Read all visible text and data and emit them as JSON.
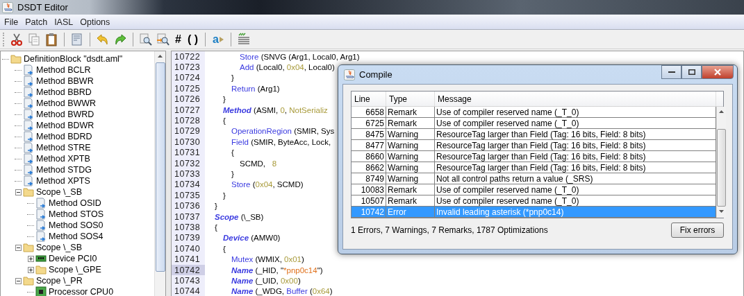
{
  "window": {
    "title": "DSDT Editor"
  },
  "menu": [
    "File",
    "Patch",
    "IASL",
    "Options"
  ],
  "toolbar": [
    {
      "kind": "cut"
    },
    {
      "kind": "copy"
    },
    {
      "kind": "paste"
    },
    {
      "kind": "separator"
    },
    {
      "kind": "document"
    },
    {
      "kind": "separator"
    },
    {
      "kind": "undo"
    },
    {
      "kind": "redo"
    },
    {
      "kind": "separator"
    },
    {
      "kind": "search"
    },
    {
      "kind": "find-next"
    },
    {
      "kind": "text",
      "label": "#"
    },
    {
      "kind": "text",
      "label": "( )"
    },
    {
      "kind": "separator"
    },
    {
      "kind": "text-arrow",
      "label": "a"
    },
    {
      "kind": "separator"
    },
    {
      "kind": "lines"
    }
  ],
  "tree": [
    {
      "kind": "root",
      "label": "DefinitionBlock \"dsdt.aml\"",
      "children": [
        {
          "kind": "method",
          "label": "Method BCLR"
        },
        {
          "kind": "method",
          "label": "Method BBWR"
        },
        {
          "kind": "method",
          "label": "Method BBRD"
        },
        {
          "kind": "method",
          "label": "Method BWWR"
        },
        {
          "kind": "method",
          "label": "Method BWRD"
        },
        {
          "kind": "method",
          "label": "Method BDWR"
        },
        {
          "kind": "method",
          "label": "Method BDRD"
        },
        {
          "kind": "method",
          "label": "Method STRE"
        },
        {
          "kind": "method",
          "label": "Method XPTB"
        },
        {
          "kind": "method",
          "label": "Method STDG"
        },
        {
          "kind": "method",
          "label": "Method XPTS"
        },
        {
          "kind": "scope",
          "label": "Scope \\_SB",
          "expanded": true,
          "children": [
            {
              "kind": "method",
              "label": "Method OSID"
            },
            {
              "kind": "method",
              "label": "Method STOS"
            },
            {
              "kind": "method",
              "label": "Method SOS0"
            },
            {
              "kind": "method",
              "label": "Method SOS4"
            }
          ]
        },
        {
          "kind": "scope",
          "label": "Scope \\_SB",
          "expanded": true,
          "children": [
            {
              "kind": "device",
              "label": "Device PCI0",
              "expanded": false
            },
            {
              "kind": "scope",
              "label": "Scope \\_GPE",
              "expanded": false
            }
          ]
        },
        {
          "kind": "scope",
          "label": "Scope \\_PR",
          "expanded": true,
          "children": [
            {
              "kind": "processor",
              "label": "Processor CPU0"
            }
          ]
        }
      ]
    }
  ],
  "editor": {
    "lines": [
      {
        "number": "10722",
        "selected": false,
        "tokens": [
          {
            "kind": "kw",
            "text": "Store"
          },
          {
            "kind": "plain",
            "text": " (SNVG (Arg1, Local0, Arg1)"
          }
        ]
      },
      {
        "number": "10723",
        "selected": false,
        "tokens": [
          {
            "kind": "kw",
            "text": "Add"
          },
          {
            "kind": "plain",
            "text": " (Local0, "
          },
          {
            "kind": "num",
            "text": "0x04"
          },
          {
            "kind": "plain",
            "text": ", Local0)"
          }
        ]
      },
      {
        "number": "10724",
        "selected": false,
        "tokens": [
          {
            "kind": "plain",
            "text": "}"
          }
        ]
      },
      {
        "number": "10725",
        "selected": false,
        "tokens": [
          {
            "kind": "kw",
            "text": "Return"
          },
          {
            "kind": "plain",
            "text": " (Arg1)"
          }
        ]
      },
      {
        "number": "10726",
        "selected": false,
        "tokens": [
          {
            "kind": "plain",
            "text": "}"
          }
        ]
      },
      {
        "number": "10727",
        "selected": false,
        "tokens": [
          {
            "kind": "decl",
            "text": "Method"
          },
          {
            "kind": "plain",
            "text": " (ASMI, "
          },
          {
            "kind": "num",
            "text": "0"
          },
          {
            "kind": "plain",
            "text": ", "
          },
          {
            "kind": "num",
            "text": "NotSerializ"
          }
        ]
      },
      {
        "number": "10728",
        "selected": false,
        "tokens": [
          {
            "kind": "plain",
            "text": "{"
          }
        ]
      },
      {
        "number": "10729",
        "selected": false,
        "tokens": [
          {
            "kind": "kw",
            "text": "OperationRegion"
          },
          {
            "kind": "plain",
            "text": " (SMIR, Sys"
          }
        ]
      },
      {
        "number": "10730",
        "selected": false,
        "tokens": [
          {
            "kind": "kw",
            "text": "Field"
          },
          {
            "kind": "plain",
            "text": " (SMIR, ByteAcc, Lock,"
          }
        ]
      },
      {
        "number": "10731",
        "selected": false,
        "tokens": [
          {
            "kind": "plain",
            "text": "{"
          }
        ]
      },
      {
        "number": "10732",
        "selected": false,
        "tokens": [
          {
            "kind": "plain",
            "text": "SCMD,   "
          },
          {
            "kind": "num",
            "text": "8"
          }
        ]
      },
      {
        "number": "10733",
        "selected": false,
        "tokens": [
          {
            "kind": "plain",
            "text": "}"
          }
        ]
      },
      {
        "number": "10734",
        "selected": false,
        "tokens": [
          {
            "kind": "kw",
            "text": "Store"
          },
          {
            "kind": "plain",
            "text": " ("
          },
          {
            "kind": "num",
            "text": "0x04"
          },
          {
            "kind": "plain",
            "text": ", SCMD)"
          }
        ]
      },
      {
        "number": "10735",
        "selected": false,
        "tokens": [
          {
            "kind": "plain",
            "text": "}"
          }
        ]
      },
      {
        "number": "10736",
        "selected": false,
        "tokens": [
          {
            "kind": "plain",
            "text": "}"
          }
        ]
      },
      {
        "number": "10737",
        "selected": false,
        "tokens": [
          {
            "kind": "decl",
            "text": "Scope"
          },
          {
            "kind": "plain",
            "text": " (\\_SB)"
          }
        ]
      },
      {
        "number": "10738",
        "selected": false,
        "tokens": [
          {
            "kind": "plain",
            "text": "{"
          }
        ]
      },
      {
        "number": "10739",
        "selected": false,
        "tokens": [
          {
            "kind": "decl",
            "text": "Device"
          },
          {
            "kind": "plain",
            "text": " (AMW0)"
          }
        ]
      },
      {
        "number": "10740",
        "selected": false,
        "tokens": [
          {
            "kind": "plain",
            "text": "{"
          }
        ]
      },
      {
        "number": "10741",
        "selected": false,
        "tokens": [
          {
            "kind": "kw",
            "text": "Mutex"
          },
          {
            "kind": "plain",
            "text": " (WMIX, "
          },
          {
            "kind": "num",
            "text": "0x01"
          },
          {
            "kind": "plain",
            "text": ")"
          }
        ]
      },
      {
        "number": "10742",
        "selected": true,
        "tokens": [
          {
            "kind": "decl",
            "text": "Name"
          },
          {
            "kind": "plain",
            "text": " (_HID, \""
          },
          {
            "kind": "str",
            "text": "*pnp0c14"
          },
          {
            "kind": "plain",
            "text": "\")"
          }
        ]
      },
      {
        "number": "10743",
        "selected": false,
        "tokens": [
          {
            "kind": "decl",
            "text": "Name"
          },
          {
            "kind": "plain",
            "text": " (_UID, "
          },
          {
            "kind": "num",
            "text": "0x00"
          },
          {
            "kind": "plain",
            "text": ")"
          }
        ]
      },
      {
        "number": "10744",
        "selected": false,
        "tokens": [
          {
            "kind": "decl",
            "text": "Name"
          },
          {
            "kind": "plain",
            "text": " (_WDG, "
          },
          {
            "kind": "kw",
            "text": "Buffer"
          },
          {
            "kind": "plain",
            "text": " ("
          },
          {
            "kind": "num",
            "text": "0x64"
          },
          {
            "kind": "plain",
            "text": ")"
          }
        ]
      }
    ]
  },
  "compile_dialog": {
    "title": "Compile",
    "columns": [
      "Line",
      "Type",
      "Message"
    ],
    "rows": [
      {
        "line": "6658",
        "type": "Remark",
        "message": "Use of compiler reserved name (_T_0)",
        "selected": false
      },
      {
        "line": "6725",
        "type": "Remark",
        "message": "Use of compiler reserved name (_T_0)",
        "selected": false
      },
      {
        "line": "8475",
        "type": "Warning",
        "message": "ResourceTag larger than Field (Tag: 16 bits, Field: 8 bits)",
        "selected": false
      },
      {
        "line": "8477",
        "type": "Warning",
        "message": "ResourceTag larger than Field (Tag: 16 bits, Field: 8 bits)",
        "selected": false
      },
      {
        "line": "8660",
        "type": "Warning",
        "message": "ResourceTag larger than Field (Tag: 16 bits, Field: 8 bits)",
        "selected": false
      },
      {
        "line": "8662",
        "type": "Warning",
        "message": "ResourceTag larger than Field (Tag: 16 bits, Field: 8 bits)",
        "selected": false
      },
      {
        "line": "8749",
        "type": "Warning",
        "message": "Not all control paths return a value (_SRS)",
        "selected": false
      },
      {
        "line": "10083",
        "type": "Remark",
        "message": "Use of compiler reserved name (_T_0)",
        "selected": false
      },
      {
        "line": "10507",
        "type": "Remark",
        "message": "Use of compiler reserved name (_T_0)",
        "selected": false
      },
      {
        "line": "10742",
        "type": "Error",
        "message": "Invalid leading asterisk (*pnp0c14)",
        "selected": true
      }
    ],
    "summary": "1 Errors, 7 Warnings, 7 Remarks, 1787 Optimizations",
    "button": "Fix errors"
  }
}
